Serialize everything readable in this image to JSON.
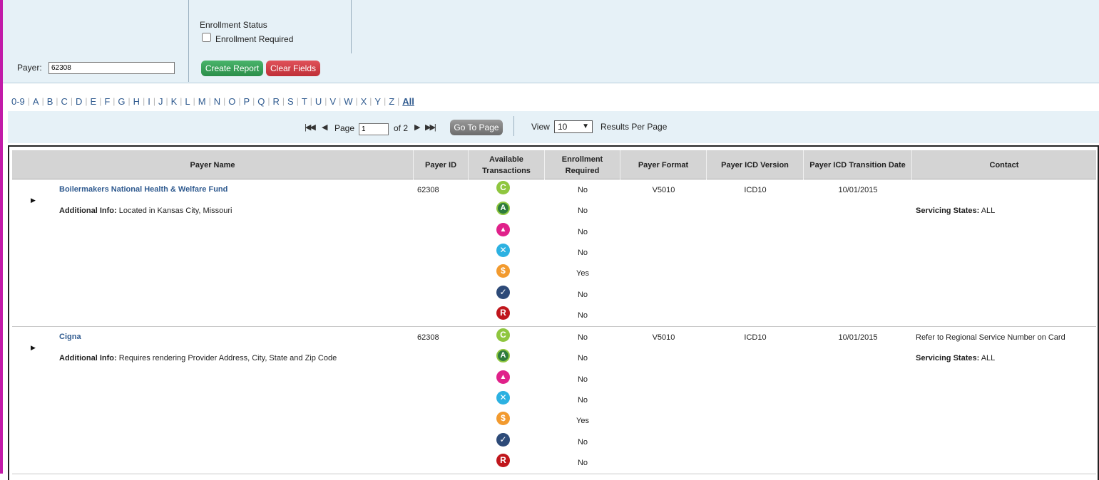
{
  "filters": {
    "payer_label": "Payer:",
    "payer_value": "62308",
    "enrollment_status_title": "Enrollment Status",
    "enrollment_required_label": "Enrollment Required",
    "create_report_label": "Create Report",
    "clear_fields_label": "Clear Fields"
  },
  "alphabet": [
    "0-9",
    "A",
    "B",
    "C",
    "D",
    "E",
    "F",
    "G",
    "H",
    "I",
    "J",
    "K",
    "L",
    "M",
    "N",
    "O",
    "P",
    "Q",
    "R",
    "S",
    "T",
    "U",
    "V",
    "W",
    "X",
    "Y",
    "Z",
    "All"
  ],
  "pager": {
    "page_label": "Page",
    "current_page": "1",
    "of_label": "of 2",
    "go_to_page_label": "Go To Page",
    "view_label": "View",
    "per_page_value": "10",
    "results_per_page_label": "Results Per Page"
  },
  "columns": {
    "payer_name": "Payer Name",
    "payer_id": "Payer ID",
    "available_transactions_1": "Available",
    "available_transactions_2": "Transactions",
    "enrollment_required_1": "Enrollment",
    "enrollment_required_2": "Required",
    "payer_format": "Payer Format",
    "payer_icd_version": "Payer ICD Version",
    "payer_icd_transition_date": "Payer ICD Transition Date",
    "contact": "Contact"
  },
  "transaction_icons": [
    {
      "name": "claims-icon",
      "glyph": "C"
    },
    {
      "name": "eligibility-icon",
      "glyph": "A"
    },
    {
      "name": "referral-icon",
      "glyph": "▲"
    },
    {
      "name": "claim-status-icon",
      "glyph": "✕"
    },
    {
      "name": "remittance-icon",
      "glyph": "$"
    },
    {
      "name": "verification-icon",
      "glyph": "✓"
    },
    {
      "name": "registration-icon",
      "glyph": "R"
    }
  ],
  "rows": [
    {
      "payer_name": "Boilermakers National Health & Welfare Fund",
      "additional_info_label": "Additional Info:",
      "additional_info": " Located in Kansas City, Missouri",
      "payer_id": "62308",
      "enrollment": [
        "No",
        "No",
        "No",
        "No",
        "Yes",
        "No",
        "No"
      ],
      "payer_format": "V5010",
      "icd_version": "ICD10",
      "transition_date": "10/01/2015",
      "contact": "",
      "servicing_label": "Servicing States:",
      "servicing_states": " ALL"
    },
    {
      "payer_name": "Cigna",
      "additional_info_label": "Additional Info:",
      "additional_info": " Requires rendering Provider Address, City, State and Zip Code",
      "payer_id": "62308",
      "enrollment": [
        "No",
        "No",
        "No",
        "No",
        "Yes",
        "No",
        "No"
      ],
      "payer_format": "V5010",
      "icd_version": "ICD10",
      "transition_date": "10/01/2015",
      "contact": "Refer to Regional Service Number on Card",
      "servicing_label": "Servicing States:",
      "servicing_states": " ALL"
    }
  ]
}
